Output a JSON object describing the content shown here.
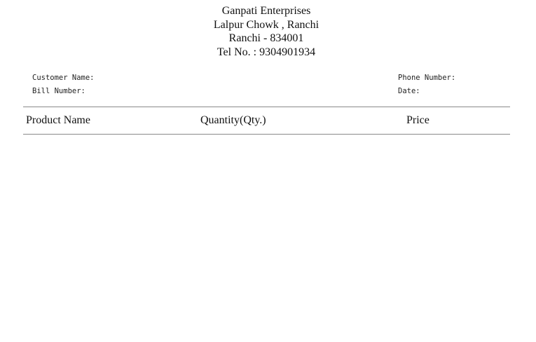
{
  "store": {
    "name": "Ganpati Enterprises",
    "address_line1": "Lalpur Chowk , Ranchi",
    "address_line2": "Ranchi - 834001",
    "tel": "Tel No. : 9304901934"
  },
  "fields": {
    "customer_name_label": "Customer Name:",
    "bill_number_label": "Bill Number:",
    "phone_number_label": "Phone Number:",
    "date_label": "Date:"
  },
  "table": {
    "columns": [
      "Product Name",
      "Quantity(Qty.)",
      "Price"
    ]
  }
}
